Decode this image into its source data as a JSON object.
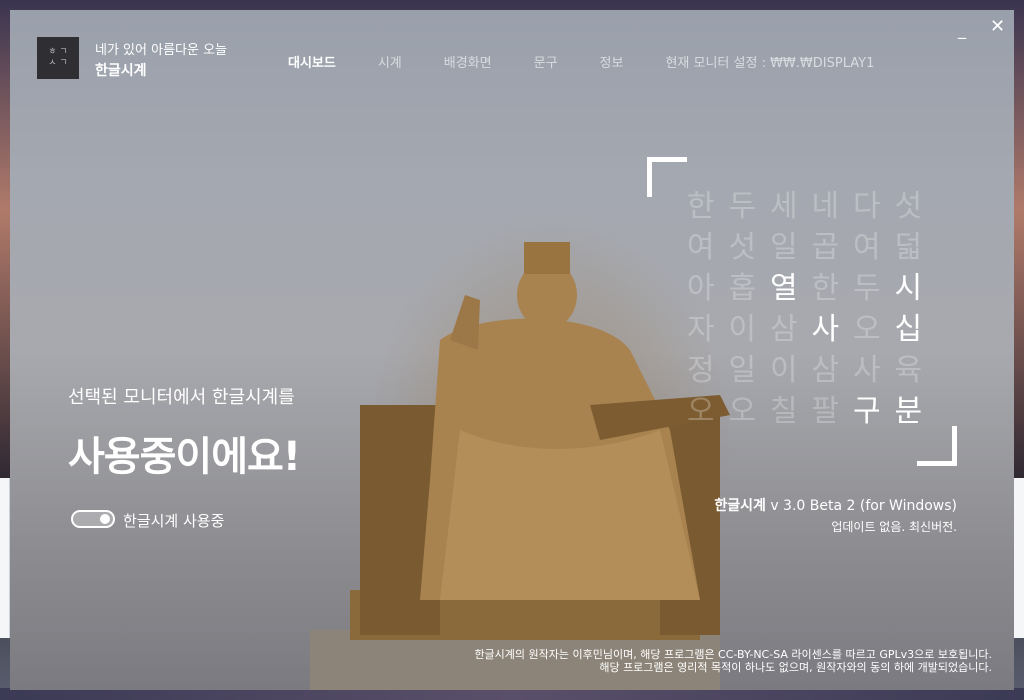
{
  "app": {
    "logo_text_top": "ㅎ ㄱ",
    "logo_text_bottom": "ㅅ ㄱ",
    "subtitle": "네가 있어 아름다운 오늘",
    "title": "한글시계"
  },
  "nav": {
    "items": [
      {
        "label": "대시보드"
      },
      {
        "label": "시계"
      },
      {
        "label": "배경화면"
      },
      {
        "label": "문구"
      },
      {
        "label": "정보"
      }
    ],
    "monitor_setting": "현재 모니터 설정 : ₩₩.₩DISPLAY1"
  },
  "window_controls": {
    "minimize": "_",
    "close": "✕"
  },
  "status": {
    "selected_text": "선택된 모니터에서 한글시계를",
    "using_text": "사용중이에요!",
    "toggle_on": true,
    "toggle_label": "한글시계 사용중"
  },
  "clock": {
    "rows": [
      [
        {
          "c": "한",
          "on": false
        },
        {
          "c": "두",
          "on": false
        },
        {
          "c": "세",
          "on": false
        },
        {
          "c": "네",
          "on": false
        },
        {
          "c": "다",
          "on": false
        },
        {
          "c": "섯",
          "on": false
        }
      ],
      [
        {
          "c": "여",
          "on": false
        },
        {
          "c": "섯",
          "on": false
        },
        {
          "c": "일",
          "on": false
        },
        {
          "c": "곱",
          "on": false
        },
        {
          "c": "여",
          "on": false
        },
        {
          "c": "덟",
          "on": false
        }
      ],
      [
        {
          "c": "아",
          "on": false
        },
        {
          "c": "홉",
          "on": false
        },
        {
          "c": "열",
          "on": true
        },
        {
          "c": "한",
          "on": false
        },
        {
          "c": "두",
          "on": false
        },
        {
          "c": "시",
          "on": true
        }
      ],
      [
        {
          "c": "자",
          "on": false
        },
        {
          "c": "이",
          "on": false
        },
        {
          "c": "삼",
          "on": false
        },
        {
          "c": "사",
          "on": true
        },
        {
          "c": "오",
          "on": false
        },
        {
          "c": "십",
          "on": true
        }
      ],
      [
        {
          "c": "정",
          "on": false
        },
        {
          "c": "일",
          "on": false
        },
        {
          "c": "이",
          "on": false
        },
        {
          "c": "삼",
          "on": false
        },
        {
          "c": "사",
          "on": false
        },
        {
          "c": "육",
          "on": false
        }
      ],
      [
        {
          "c": "오",
          "on": false
        },
        {
          "c": "오",
          "on": false
        },
        {
          "c": "칠",
          "on": false
        },
        {
          "c": "팔",
          "on": false
        },
        {
          "c": "구",
          "on": true
        },
        {
          "c": "분",
          "on": true
        }
      ]
    ]
  },
  "version": {
    "name": "한글시계",
    "ver": " v 3.0 Beta 2 (for Windows)",
    "update_status": "업데이트 없음. 최신버전."
  },
  "credits": {
    "line1": "한글시계의 원작자는 이후민님이며, 해당 프로그램은 CC-BY-NC-SA 라이센스를 따르고 GPLv3으로 보호됩니다.",
    "line2": "해당 프로그램은 영리적 목적이 하나도 없으며, 원작자와의 동의 하에 개발되었습니다."
  }
}
